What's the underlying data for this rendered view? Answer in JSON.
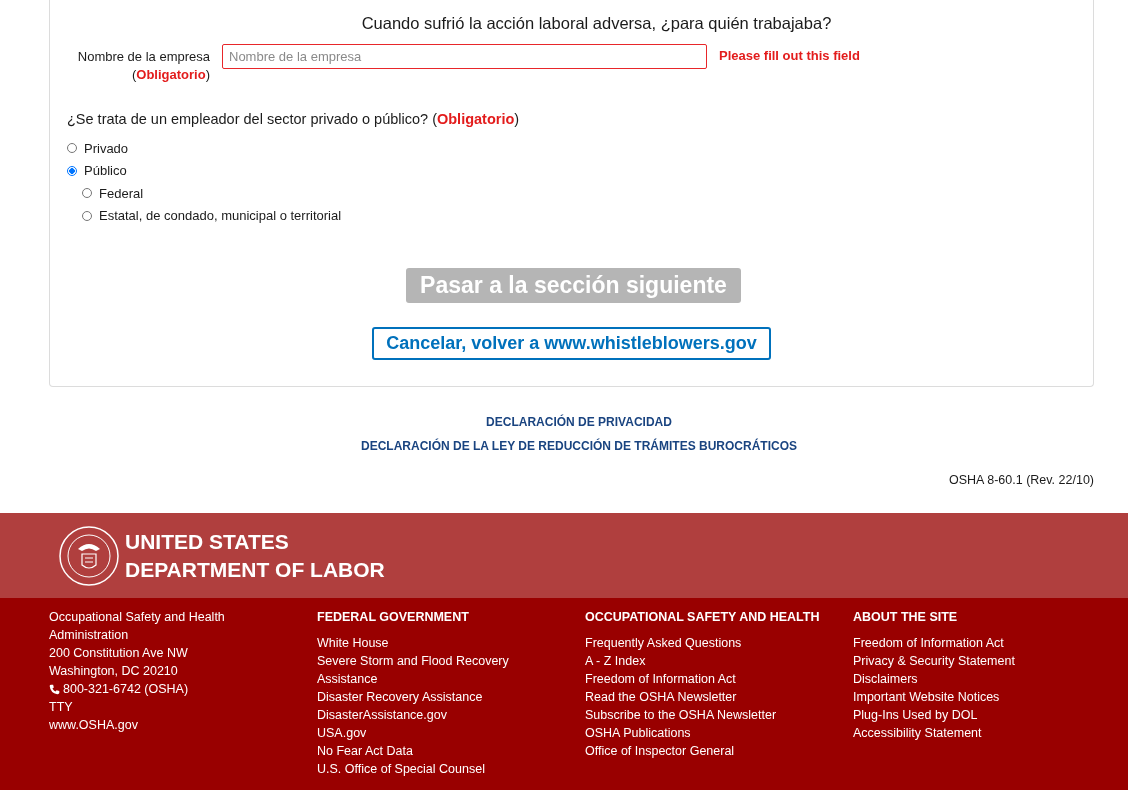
{
  "form": {
    "heading": "Cuando sufrió la acción laboral adversa, ¿para quién trabajaba?",
    "company_field": {
      "label": "Nombre de la empresa",
      "required": "(**Obligatorio**)",
      "placeholder": "Nombre de la empresa",
      "error": "Please fill out this field"
    },
    "sector_question": "¿Se trata de un empleador del sector privado o público? (**Obligatorio**)",
    "sector_options": [
      {
        "label": "Privado",
        "selected": false
      },
      {
        "label": "Público",
        "selected": true,
        "children": [
          {
            "label": "Federal",
            "selected": false
          },
          {
            "label": "Estatal, de condado, municipal o territorial",
            "selected": false
          }
        ]
      }
    ],
    "next_button": {
      "label": "Pasar a la sección siguiente",
      "disabled": true
    },
    "cancel_button": "Cancelar, volver a www.whistleblowers.gov"
  },
  "links": [
    "DECLARACIÓN DE PRIVACIDAD",
    "DECLARACIÓN DE LA LEY DE REDUCCIÓN DE TRÁMITES BUROCRÁTICOS"
  ],
  "form_version": "OSHA 8-60.1 (Rev. 22/10)",
  "footer": {
    "agency": [
      "UNITED STATES",
      "DEPARTMENT OF LABOR"
    ],
    "address": [
      {
        "kind": "text",
        "text": "Occupational Safety and Health Administration"
      },
      {
        "kind": "text",
        "text": "200 Constitution Ave NW"
      },
      {
        "kind": "text",
        "text": "Washington, DC 20210"
      },
      {
        "kind": "phone",
        "text": "800-321-6742 (OSHA)"
      },
      {
        "kind": "link",
        "text": "TTY"
      },
      {
        "kind": "link",
        "text": "www.OSHA.gov"
      }
    ],
    "columns": [
      {
        "title": "FEDERAL GOVERNMENT",
        "links": [
          "White House",
          "Severe Storm and Flood Recovery Assistance",
          "Disaster Recovery Assistance",
          "DisasterAssistance.gov",
          "USA.gov",
          "No Fear Act Data",
          "U.S. Office of Special Counsel"
        ]
      },
      {
        "title": "OCCUPATIONAL SAFETY AND HEALTH",
        "links": [
          "Frequently Asked Questions",
          "A - Z Index",
          "Freedom of Information Act",
          "Read the OSHA Newsletter",
          "Subscribe to the OSHA Newsletter",
          "OSHA Publications",
          "Office of Inspector General"
        ]
      },
      {
        "title": "ABOUT THE SITE",
        "links": [
          "Freedom of Information Act",
          "Privacy & Security Statement",
          "Disclaimers",
          "Important Website Notices",
          "Plug-Ins Used by DOL",
          "Accessibility Statement"
        ]
      }
    ]
  }
}
